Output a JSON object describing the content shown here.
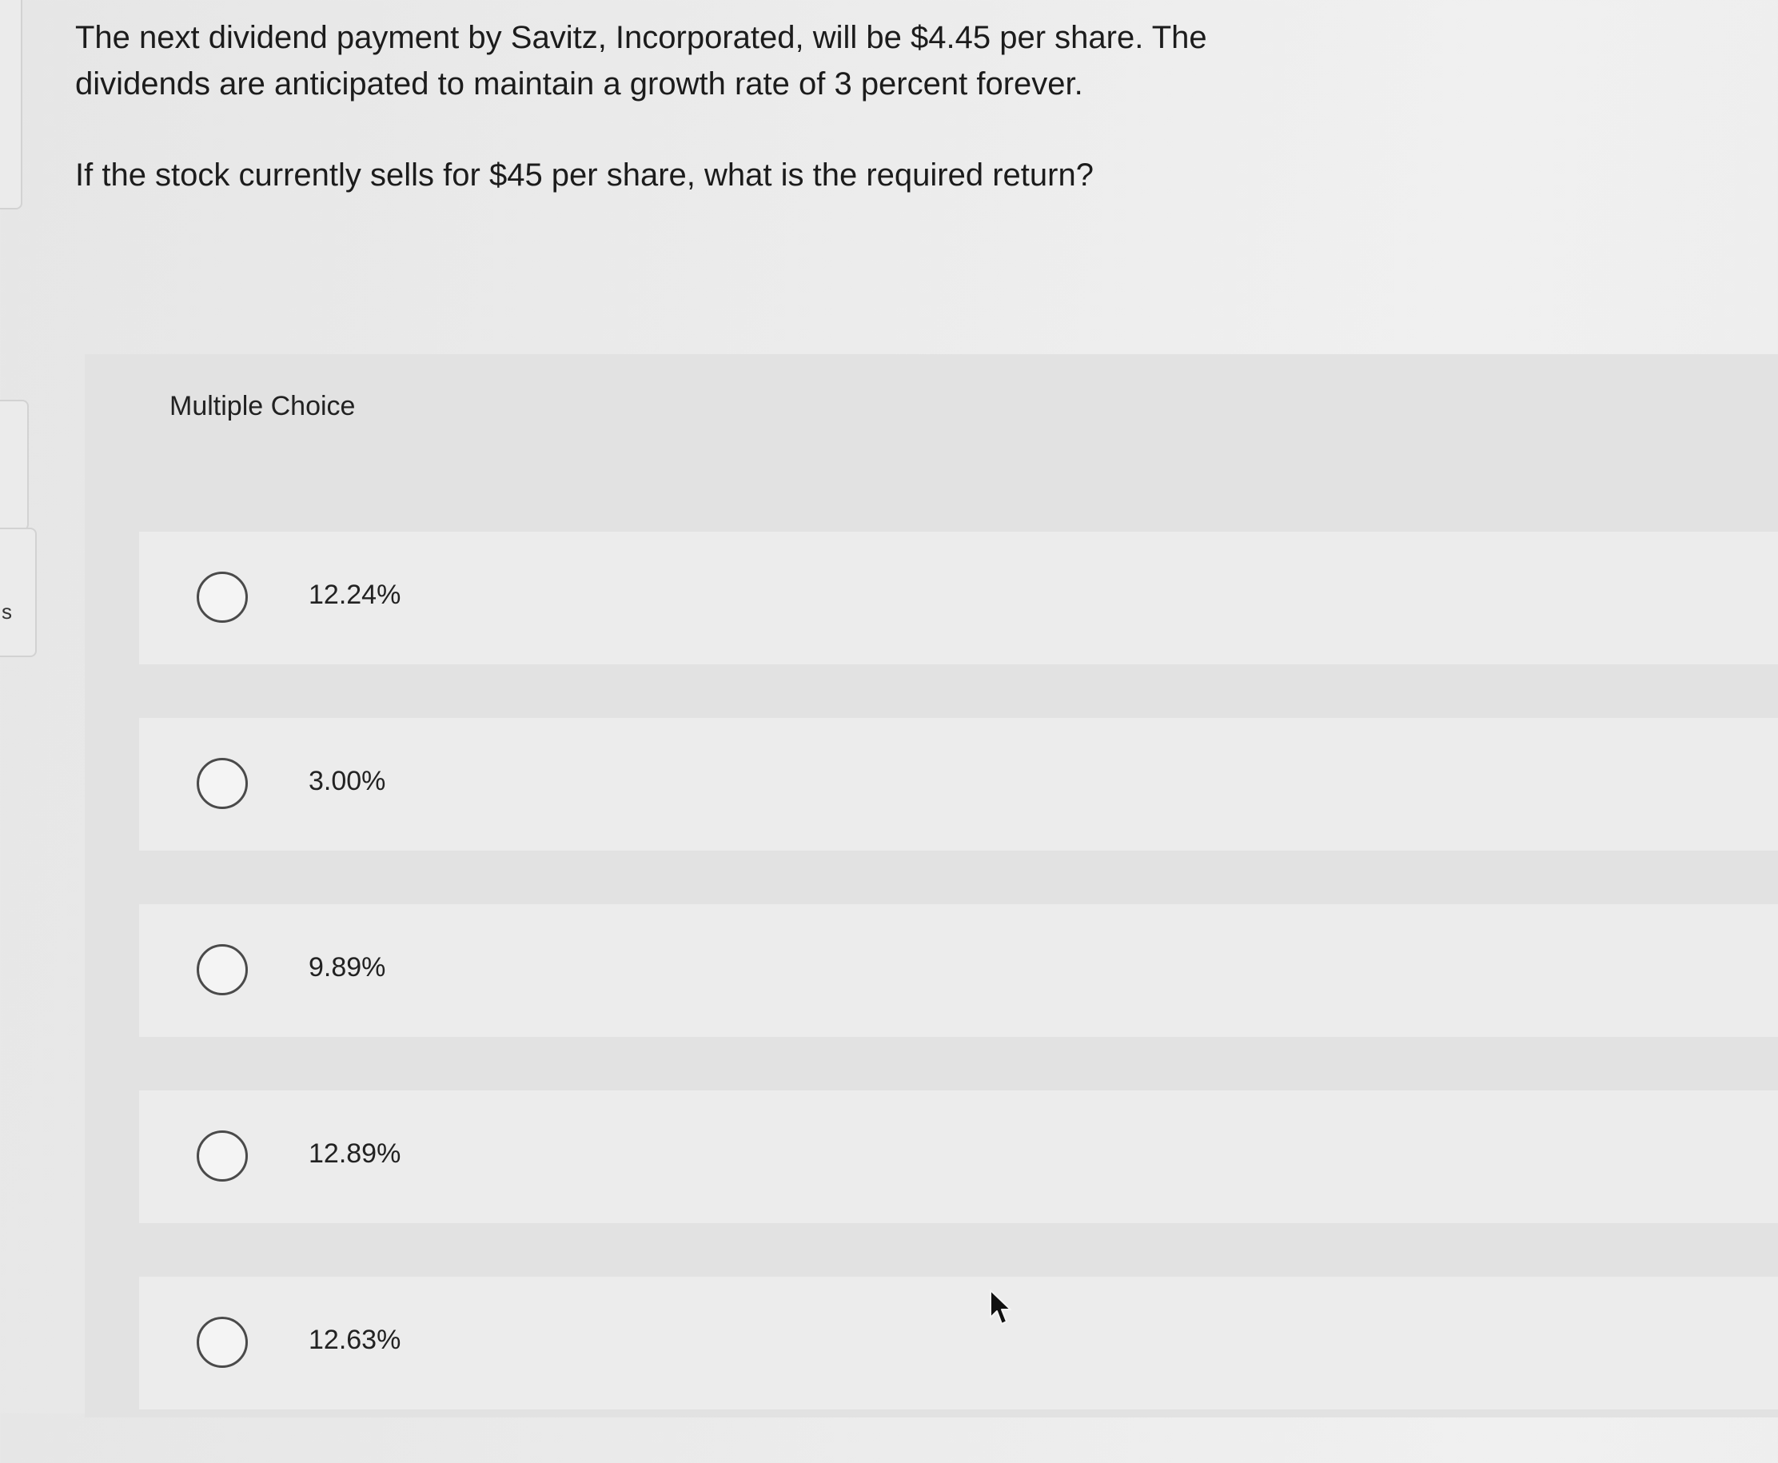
{
  "left_rail": {
    "letter": "s"
  },
  "question": {
    "stem": "The next dividend payment by Savitz, Incorporated, will be $4.45 per share. The dividends are anticipated to maintain a growth rate of 3 percent forever.",
    "prompt": "If the stock currently sells for $45 per share, what is the required return?"
  },
  "multiple_choice": {
    "title": "Multiple Choice",
    "options": [
      {
        "label": "12.24%"
      },
      {
        "label": "3.00%"
      },
      {
        "label": "9.89%"
      },
      {
        "label": "12.89%"
      },
      {
        "label": "12.63%"
      }
    ]
  },
  "icons": {
    "cursor": "arrow-cursor-icon",
    "radio": "radio-unselected-icon"
  }
}
